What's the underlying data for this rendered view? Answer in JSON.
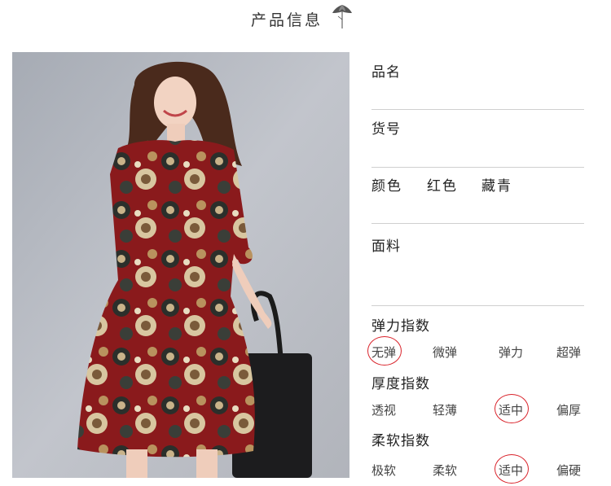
{
  "header": {
    "title": "产品信息"
  },
  "fields": {
    "name_label": "品名",
    "sku_label": "货号",
    "color_label": "颜色",
    "color_options": [
      "红色",
      "藏青"
    ],
    "fabric_label": "面料"
  },
  "scales": [
    {
      "title": "弹力指数",
      "options": [
        "无弹",
        "微弹",
        "弹力",
        "超弹"
      ],
      "selected_index": 0
    },
    {
      "title": "厚度指数",
      "options": [
        "透视",
        "轻薄",
        "适中",
        "偏厚"
      ],
      "selected_index": 2
    },
    {
      "title": "柔软指数",
      "options": [
        "极软",
        "柔软",
        "适中",
        "偏硬"
      ],
      "selected_index": 2
    }
  ],
  "colors": {
    "selection_circle": "#d9222a",
    "divider": "#cfcfcf",
    "dress_red": "#8a1a1c",
    "photo_bg": "#b8bcc4"
  }
}
